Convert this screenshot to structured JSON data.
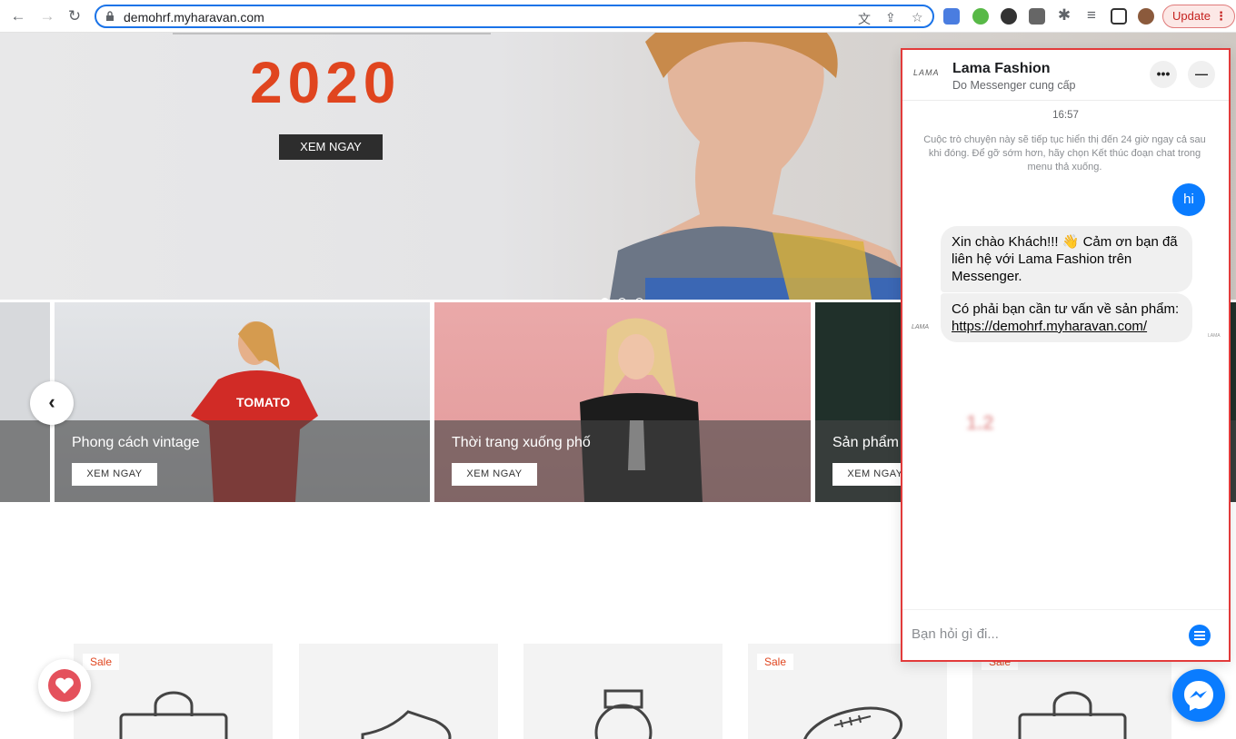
{
  "browser": {
    "url": "demohrf.myharavan.com",
    "update_label": "Update"
  },
  "hero": {
    "year": "2020",
    "cta": "XEM NGAY",
    "slides": 3,
    "active_slide": 1
  },
  "collections": [
    {
      "title": "Phong cách vintage",
      "cta": "XEM NGAY"
    },
    {
      "title": "Thời trang xuống phố",
      "cta": "XEM NGAY"
    },
    {
      "title": "Sản phẩm",
      "cta": "XEM NGAY"
    }
  ],
  "products": [
    {
      "badge": "Sale",
      "icon": "bag-icon"
    },
    {
      "badge": "",
      "icon": "shoe-icon"
    },
    {
      "badge": "",
      "icon": "watch-icon"
    },
    {
      "badge": "Sale",
      "icon": "football-icon"
    },
    {
      "badge": "Sale",
      "icon": "bag-icon"
    }
  ],
  "messenger": {
    "page_name": "Lama Fashion",
    "provider": "Do Messenger cung cấp",
    "logo_text": "LAMA",
    "time": "16:57",
    "notice": "Cuộc trò chuyện này sẽ tiếp tục hiển thị đến 24 giờ ngay cả sau khi đóng. Để gỡ sớm hơn, hãy chọn Kết thúc đoạn chat trong menu thả xuống.",
    "user_message": "hi",
    "reply_1": "Xin chào Khách!!! 👋 Cảm ơn bạn đã liên hệ với Lama Fashion trên Messenger.",
    "reply_2_text": "Có phải bạn cần tư vấn về sản phẩm:",
    "reply_2_link": "https://demohrf.myharavan.com/",
    "blur_mark": "1.2",
    "composer_placeholder": "Bạn hỏi gì đi..."
  },
  "colors": {
    "accent_blue": "#0a7cff",
    "hero_red": "#e0451f",
    "highlight_border": "#e23b3b"
  }
}
